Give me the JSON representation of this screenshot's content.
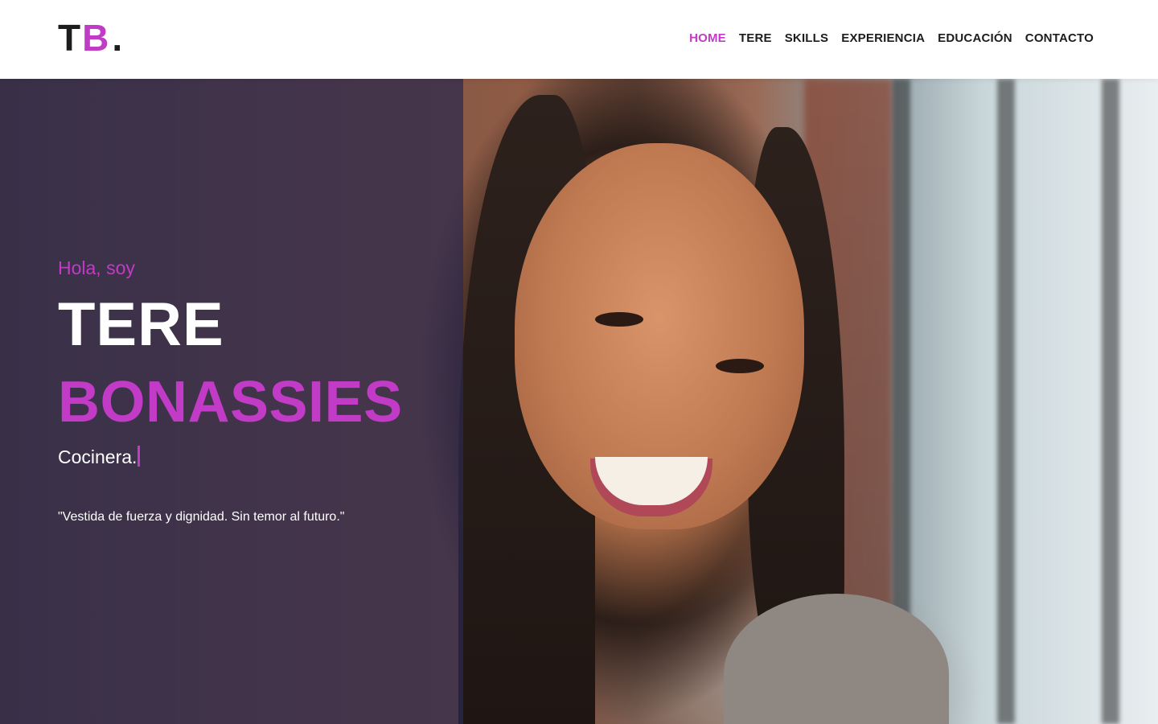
{
  "header": {
    "logo": {
      "letter_1": "T",
      "letter_2": "B",
      "dot": "."
    },
    "nav": [
      {
        "label": "HOME",
        "active": true
      },
      {
        "label": "TERE",
        "active": false
      },
      {
        "label": "SKILLS",
        "active": false
      },
      {
        "label": "EXPERIENCIA",
        "active": false
      },
      {
        "label": "EDUCACIÓN",
        "active": false
      },
      {
        "label": "CONTACTO",
        "active": false
      }
    ]
  },
  "hero": {
    "greeting": "Hola, soy",
    "first_name": "TERE",
    "last_name": "BONASSIES",
    "role": "Cocinera.",
    "quote": "\"Vestida de fuerza y dignidad. Sin temor al futuro.\""
  },
  "colors": {
    "accent": "#c13bc6",
    "text_dark": "#1d1d1d",
    "overlay": "#2c284e"
  }
}
